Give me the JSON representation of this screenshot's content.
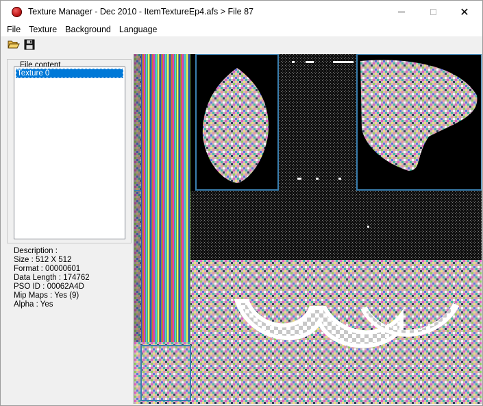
{
  "window": {
    "title": "Texture Manager - Dec 2010 - ItemTextureEp4.afs > File 87",
    "icon": "app-disc-icon"
  },
  "menu": [
    {
      "label": "File"
    },
    {
      "label": "Texture"
    },
    {
      "label": "Background"
    },
    {
      "label": "Language"
    }
  ],
  "toolbar": {
    "open_icon": "open-folder-icon",
    "save_icon": "save-disk-icon"
  },
  "file_content": {
    "group_label": "File content",
    "items": [
      {
        "label": "Texture 0",
        "selected": true
      }
    ]
  },
  "info": {
    "description": "Description :",
    "size": "Size : 512 X 512",
    "format": "Format : 00000601",
    "data_length": "Data Length : 174762",
    "pso_id": "PSO ID : 00062A4D",
    "mip_maps": "Mip Maps : Yes (9)",
    "alpha": "Alpha : Yes"
  },
  "colors": {
    "selection": "#0078d7",
    "viewer_bg": "#000000",
    "outline_blue": "#3a7fb0"
  }
}
